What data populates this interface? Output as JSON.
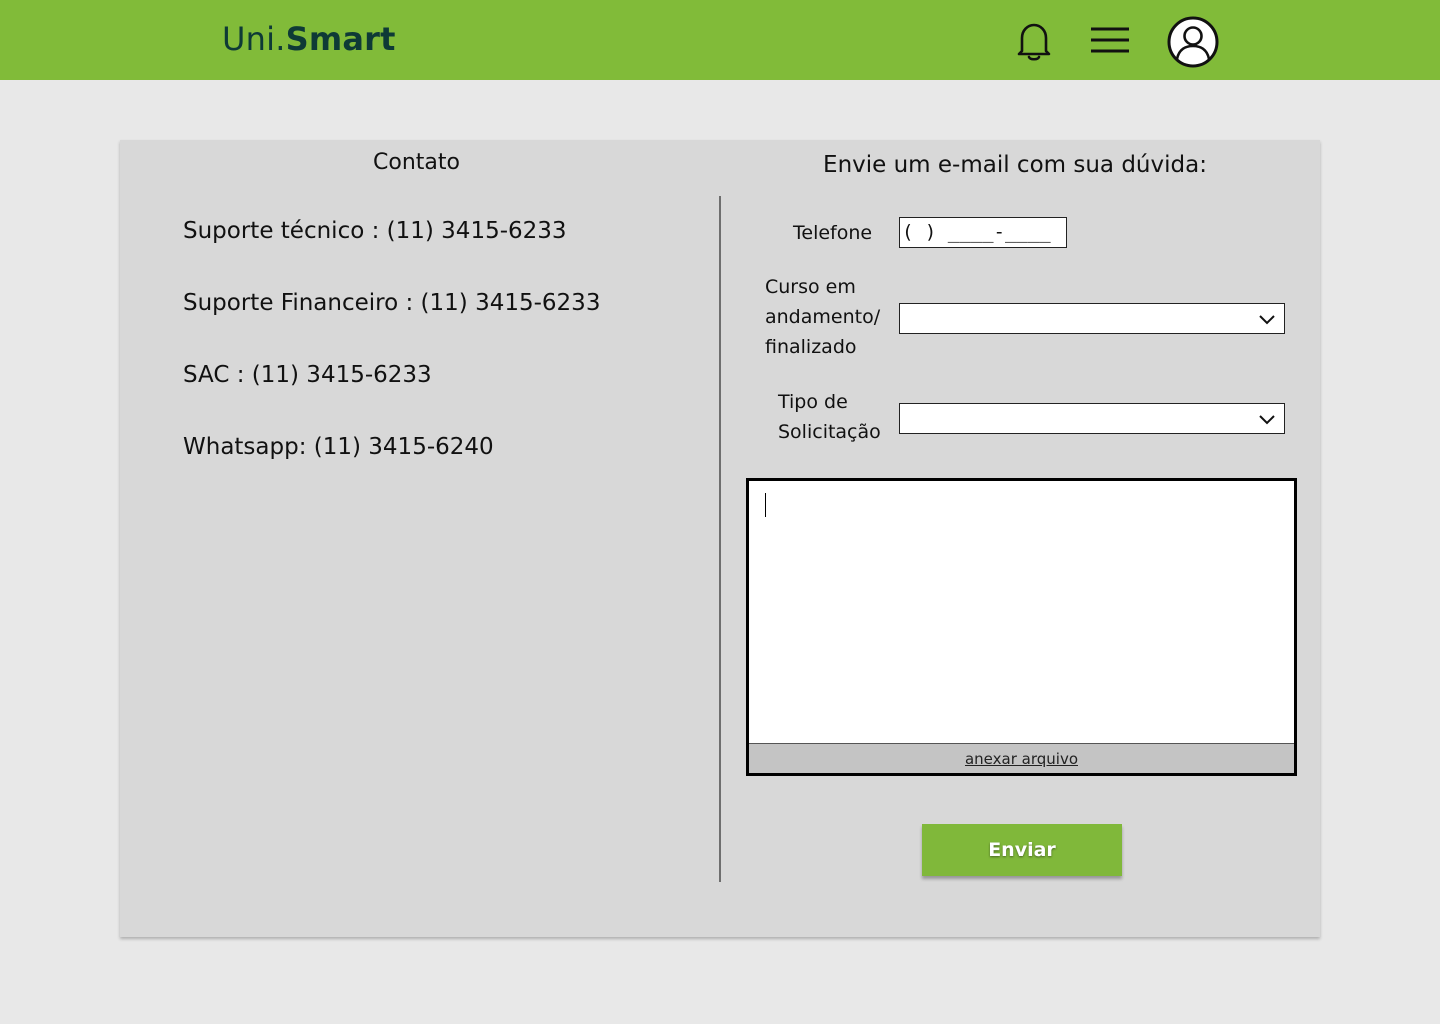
{
  "header": {
    "logo_prefix": "Uni.",
    "logo_suffix": "Smart",
    "icons": [
      "bell-icon",
      "hamburger-menu-icon",
      "user-avatar-icon"
    ],
    "colors": {
      "bar": "#81bb39",
      "logo": "#0e3a36"
    }
  },
  "contact": {
    "title": "Contato",
    "lines": [
      "Suporte técnico : (11) 3415-6233",
      "Suporte Financeiro : (11) 3415-6233",
      "SAC : (11) 3415-6233",
      "Whatsapp: (11) 3415-6240"
    ]
  },
  "form": {
    "title": "Envie um e-mail com sua dúvida:",
    "phone_label": "Telefone",
    "phone_value": "( ) ____-____",
    "course_label_lines": [
      "Curso em",
      "andamento/",
      "finalizado"
    ],
    "course_value": "",
    "request_label_lines": [
      "Tipo de",
      "Solicitação"
    ],
    "request_value": "",
    "message_value": "",
    "attach_label": "anexar arquivo",
    "send_label": "Enviar",
    "colors": {
      "send_button": "#80b83a"
    }
  }
}
